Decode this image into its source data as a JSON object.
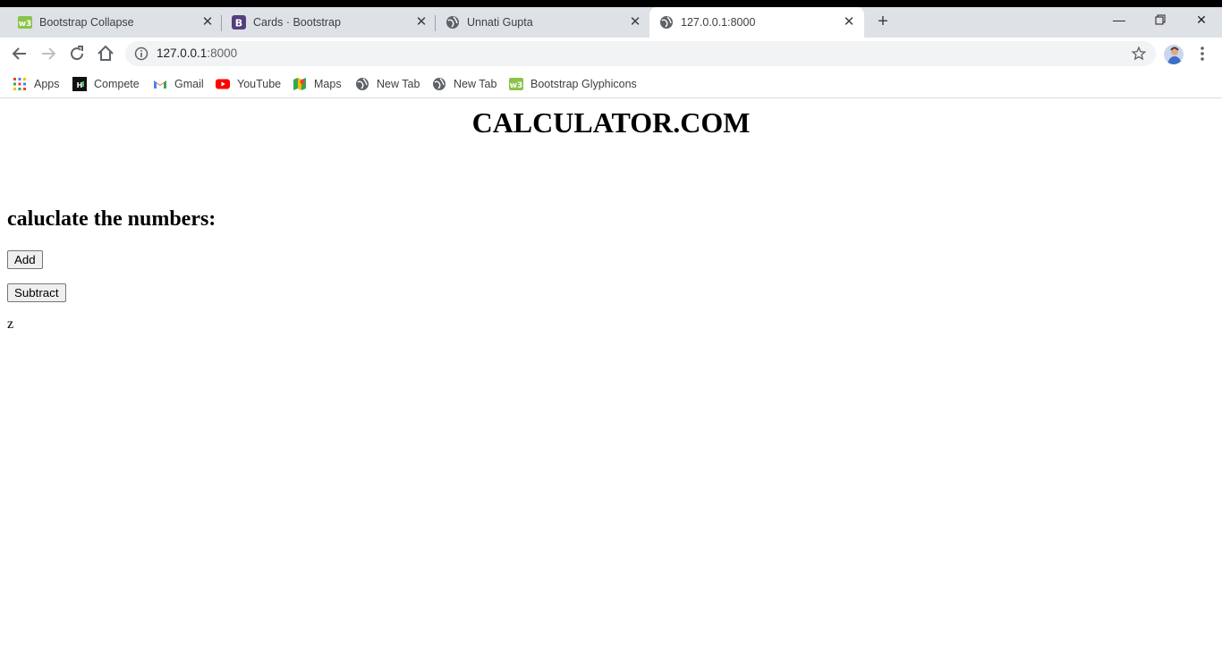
{
  "browser": {
    "tabs": [
      {
        "title": "Bootstrap Collapse",
        "favicon": "w3schools-icon",
        "active": false
      },
      {
        "title": "Cards · Bootstrap",
        "favicon": "bootstrap-icon",
        "active": false
      },
      {
        "title": "Unnati Gupta",
        "favicon": "globe-icon",
        "active": false
      },
      {
        "title": "127.0.0.1:8000",
        "favicon": "globe-icon",
        "active": true
      }
    ],
    "address": {
      "host": "127.0.0.1",
      "port": ":8000"
    },
    "bookmarks": [
      {
        "label": "Apps",
        "icon": "apps-grid-icon"
      },
      {
        "label": "Compete",
        "icon": "hackerearth-icon"
      },
      {
        "label": "Gmail",
        "icon": "gmail-icon"
      },
      {
        "label": "YouTube",
        "icon": "youtube-icon"
      },
      {
        "label": "Maps",
        "icon": "maps-icon"
      },
      {
        "label": "New Tab",
        "icon": "globe-icon"
      },
      {
        "label": "New Tab",
        "icon": "globe-icon"
      },
      {
        "label": "Bootstrap Glyphicons",
        "icon": "w3schools-icon"
      }
    ]
  },
  "page": {
    "title": "CALCULATOR.COM",
    "heading": "caluclate the numbers:",
    "add_label": "Add",
    "subtract_label": "Subtract",
    "result": "z"
  },
  "colors": {
    "tabstrip": "#dee1e6",
    "omnibox": "#f1f3f4",
    "w3schools": "#8bc34a",
    "bootstrap": "#563d7c",
    "youtube": "#ff0000"
  }
}
